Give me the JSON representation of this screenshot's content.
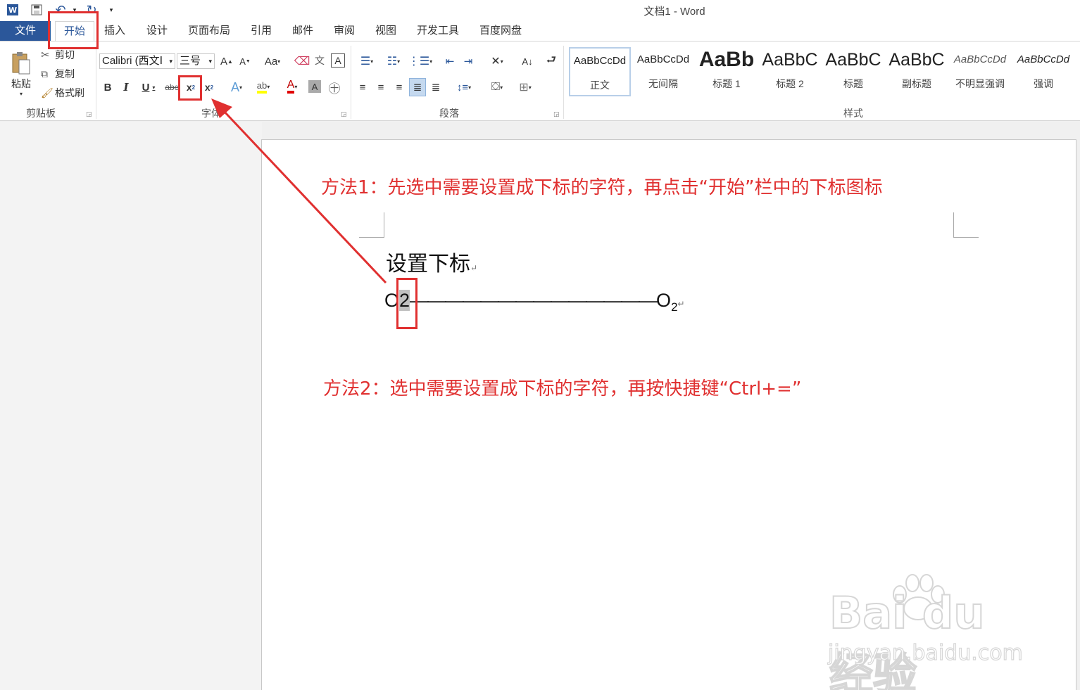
{
  "window": {
    "title": "文档1 - Word"
  },
  "tabs": [
    "文件",
    "开始",
    "插入",
    "设计",
    "页面布局",
    "引用",
    "邮件",
    "审阅",
    "视图",
    "开发工具",
    "百度网盘"
  ],
  "clipboard": {
    "paste": "粘贴",
    "cut": "剪切",
    "copy": "复制",
    "format_painter": "格式刷",
    "group": "剪贴板"
  },
  "font": {
    "name": "Calibri (西文Ⅰ",
    "size": "三号",
    "group": "字体",
    "change_case": "Aa",
    "bold": "B",
    "italic": "I",
    "underline": "U",
    "strikethrough": "abc"
  },
  "paragraph": {
    "group": "段落"
  },
  "styles": {
    "group": "样式",
    "items": [
      {
        "sample": "AaBbCcDd",
        "name": "正文"
      },
      {
        "sample": "AaBbCcDd",
        "name": "无间隔"
      },
      {
        "sample": "AaBb",
        "name": "标题 1"
      },
      {
        "sample": "AaBbC",
        "name": "标题 2"
      },
      {
        "sample": "AaBbC",
        "name": "标题"
      },
      {
        "sample": "AaBbC",
        "name": "副标题"
      },
      {
        "sample": "AaBbCcDd",
        "name": "不明显强调"
      },
      {
        "sample": "AaBbCcDd",
        "name": "强调"
      }
    ]
  },
  "document": {
    "heading": "设置下标",
    "formula_left": "O",
    "formula_selected": "2",
    "formula_dashes": "——————————————",
    "formula_right": "O",
    "formula_right_sub": "2",
    "para_mark": "↵"
  },
  "annotations": {
    "method1": "方法1：先选中需要设置成下标的字符，再点击“开始”栏中的下标图标",
    "method2": "方法2：选中需要设置成下标的字符，再按快捷键“Ctrl+=”",
    "accent": "#e03030"
  },
  "watermark": {
    "logo": "Bai du 经验",
    "url": "jingyan.baidu.com"
  }
}
